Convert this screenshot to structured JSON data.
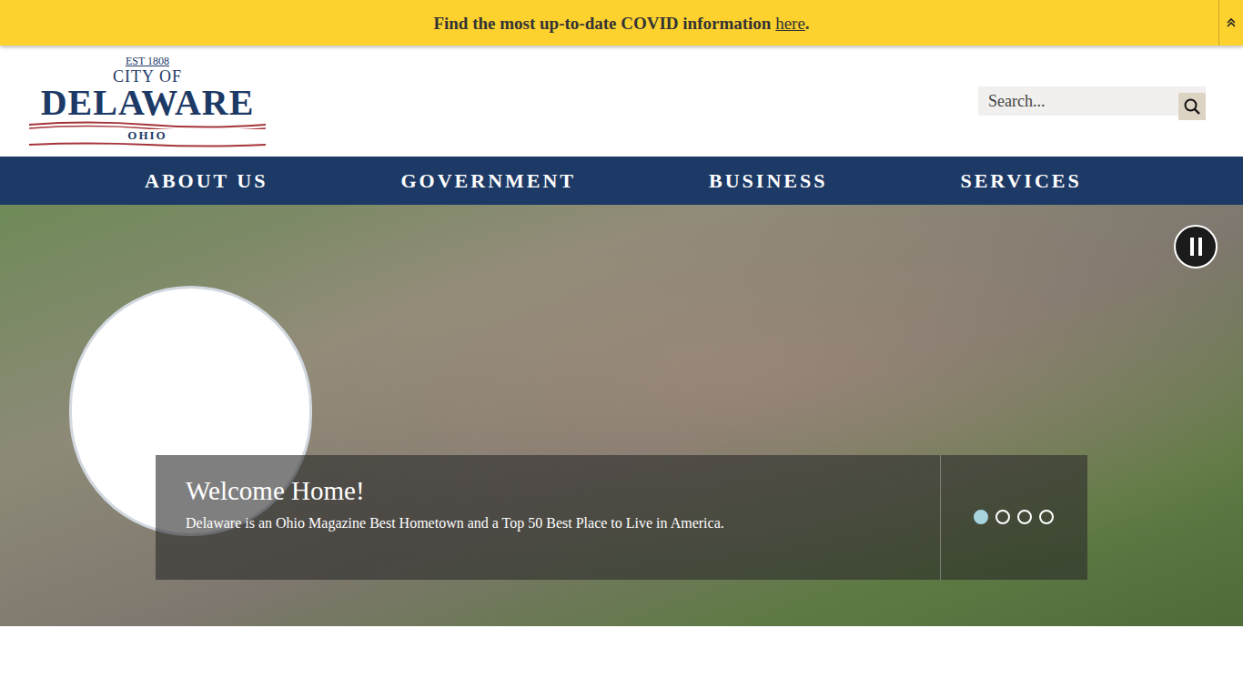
{
  "alert": {
    "text": "Find the most up-to-date COVID information ",
    "link": "here",
    "end": "."
  },
  "logo": {
    "est": "EST 1808",
    "line1": "CITY OF",
    "name": "DELAWARE",
    "state": "OHIO"
  },
  "search": {
    "placeholder": "Search..."
  },
  "nav": [
    {
      "label": "ABOUT US"
    },
    {
      "label": "GOVERNMENT"
    },
    {
      "label": "BUSINESS"
    },
    {
      "label": "SERVICES"
    }
  ],
  "slider": {
    "playing": true,
    "caption": {
      "title": "Welcome Home!",
      "text": "Delaware is an Ohio Magazine Best Hometown and a Top 50 Best Place to Live in America."
    },
    "dots": [
      {
        "selected": true
      },
      {
        "selected": false
      },
      {
        "selected": false
      },
      {
        "selected": false
      }
    ]
  }
}
